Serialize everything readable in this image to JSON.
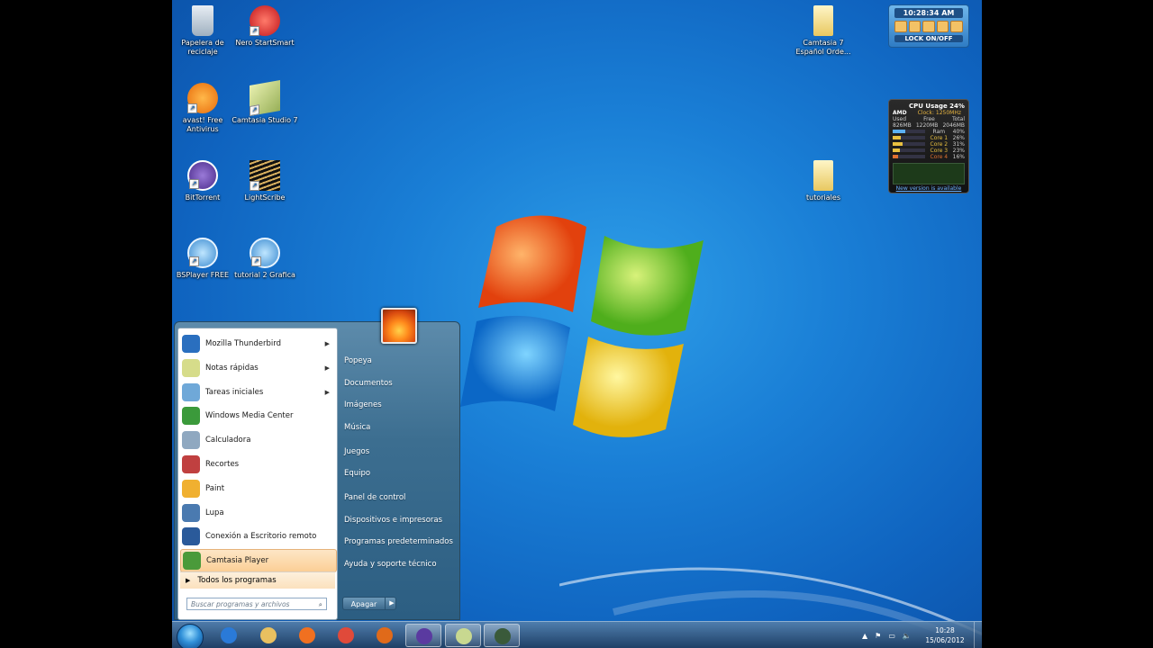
{
  "desktop": {
    "icons": [
      {
        "label": "Papelera de reciclaje",
        "icon": "recycle-bin-icon"
      },
      {
        "label": "Nero StartSmart",
        "icon": "nero-icon"
      },
      {
        "label": "avast! Free Antivirus",
        "icon": "avast-icon"
      },
      {
        "label": "Camtasia Studio 7",
        "icon": "camtasia-studio-icon"
      },
      {
        "label": "BitTorrent",
        "icon": "bittorrent-icon"
      },
      {
        "label": "LightScribe",
        "icon": "lightscribe-icon"
      },
      {
        "label": "BSPlayer FREE",
        "icon": "bsplayer-icon"
      },
      {
        "label": "tutorial 2 Grafica",
        "icon": "bsplayer-icon"
      },
      {
        "label": "Camtasia 7 Español Orde...",
        "icon": "folder-icon"
      },
      {
        "label": "tutoriales",
        "icon": "folder-icon"
      }
    ]
  },
  "gadgets": {
    "lock": {
      "time": "10:28:34 AM",
      "label": "LOCK ON/OFF"
    },
    "cpu": {
      "title": "CPU Usage 24%",
      "brand": "AMD",
      "clock": "Clock: 1250MHz",
      "headers": [
        "Used",
        "Free",
        "Total"
      ],
      "memory": [
        "826MB",
        "1220MB",
        "2046MB"
      ],
      "ram": {
        "label": "Ram",
        "value": "40%",
        "fill": 0.4
      },
      "cores": [
        {
          "label": "Core 1",
          "value": "26%",
          "fill": 0.26
        },
        {
          "label": "Core 2",
          "value": "31%",
          "fill": 0.31
        },
        {
          "label": "Core 3",
          "value": "23%",
          "fill": 0.23
        },
        {
          "label": "Core 4",
          "value": "16%",
          "fill": 0.16
        }
      ],
      "link": "New version is available"
    }
  },
  "start_menu": {
    "programs": [
      {
        "label": "Mozilla Thunderbird",
        "icon": "thunderbird-icon",
        "has_submenu": true,
        "color": "#2a6fbf"
      },
      {
        "label": "Notas rápidas",
        "icon": "sticky-notes-icon",
        "has_submenu": true,
        "color": "#d6dc8a"
      },
      {
        "label": "Tareas iniciales",
        "icon": "getting-started-icon",
        "has_submenu": true,
        "color": "#6fa8d8"
      },
      {
        "label": "Windows Media Center",
        "icon": "media-center-icon",
        "has_submenu": false,
        "color": "#3b9a3b"
      },
      {
        "label": "Calculadora",
        "icon": "calculator-icon",
        "has_submenu": false,
        "color": "#8fa8c0"
      },
      {
        "label": "Recortes",
        "icon": "snipping-tool-icon",
        "has_submenu": false,
        "color": "#c04040"
      },
      {
        "label": "Paint",
        "icon": "paint-icon",
        "has_submenu": false,
        "color": "#f0b030"
      },
      {
        "label": "Lupa",
        "icon": "magnifier-icon",
        "has_submenu": false,
        "color": "#4a7ab0"
      },
      {
        "label": "Conexión a Escritorio remoto",
        "icon": "remote-desktop-icon",
        "has_submenu": false,
        "color": "#2a5a9a"
      },
      {
        "label": "Camtasia Player",
        "icon": "camtasia-player-icon",
        "has_submenu": false,
        "color": "#4a9a3a",
        "highlighted": true
      }
    ],
    "all_programs": "Todos los programas",
    "search_placeholder": "Buscar programas y archivos",
    "right_items": [
      "Popeya",
      "Documentos",
      "Imágenes",
      "Música",
      "Juegos",
      "Equipo",
      "Panel de control",
      "Dispositivos e impresoras",
      "Programas predeterminados",
      "Ayuda y soporte técnico"
    ],
    "shutdown": "Apagar"
  },
  "taskbar": {
    "pinned": [
      {
        "icon": "internet-explorer-icon",
        "color": "#2a7ad8"
      },
      {
        "icon": "windows-explorer-icon",
        "color": "#e8c060"
      },
      {
        "icon": "media-player-icon",
        "color": "#f07020"
      },
      {
        "icon": "chrome-icon",
        "color": "#e04a3a"
      },
      {
        "icon": "firefox-icon",
        "color": "#e06a1a"
      },
      {
        "icon": "bittorrent-icon",
        "color": "#5a3aa0",
        "active": true
      },
      {
        "icon": "camtasia-studio-icon",
        "color": "#c8d890",
        "active": true
      },
      {
        "icon": "camtasia-recorder-icon",
        "color": "#3a5a3a",
        "active": true
      }
    ],
    "clock_time": "10:28",
    "clock_date": "15/06/2012"
  }
}
